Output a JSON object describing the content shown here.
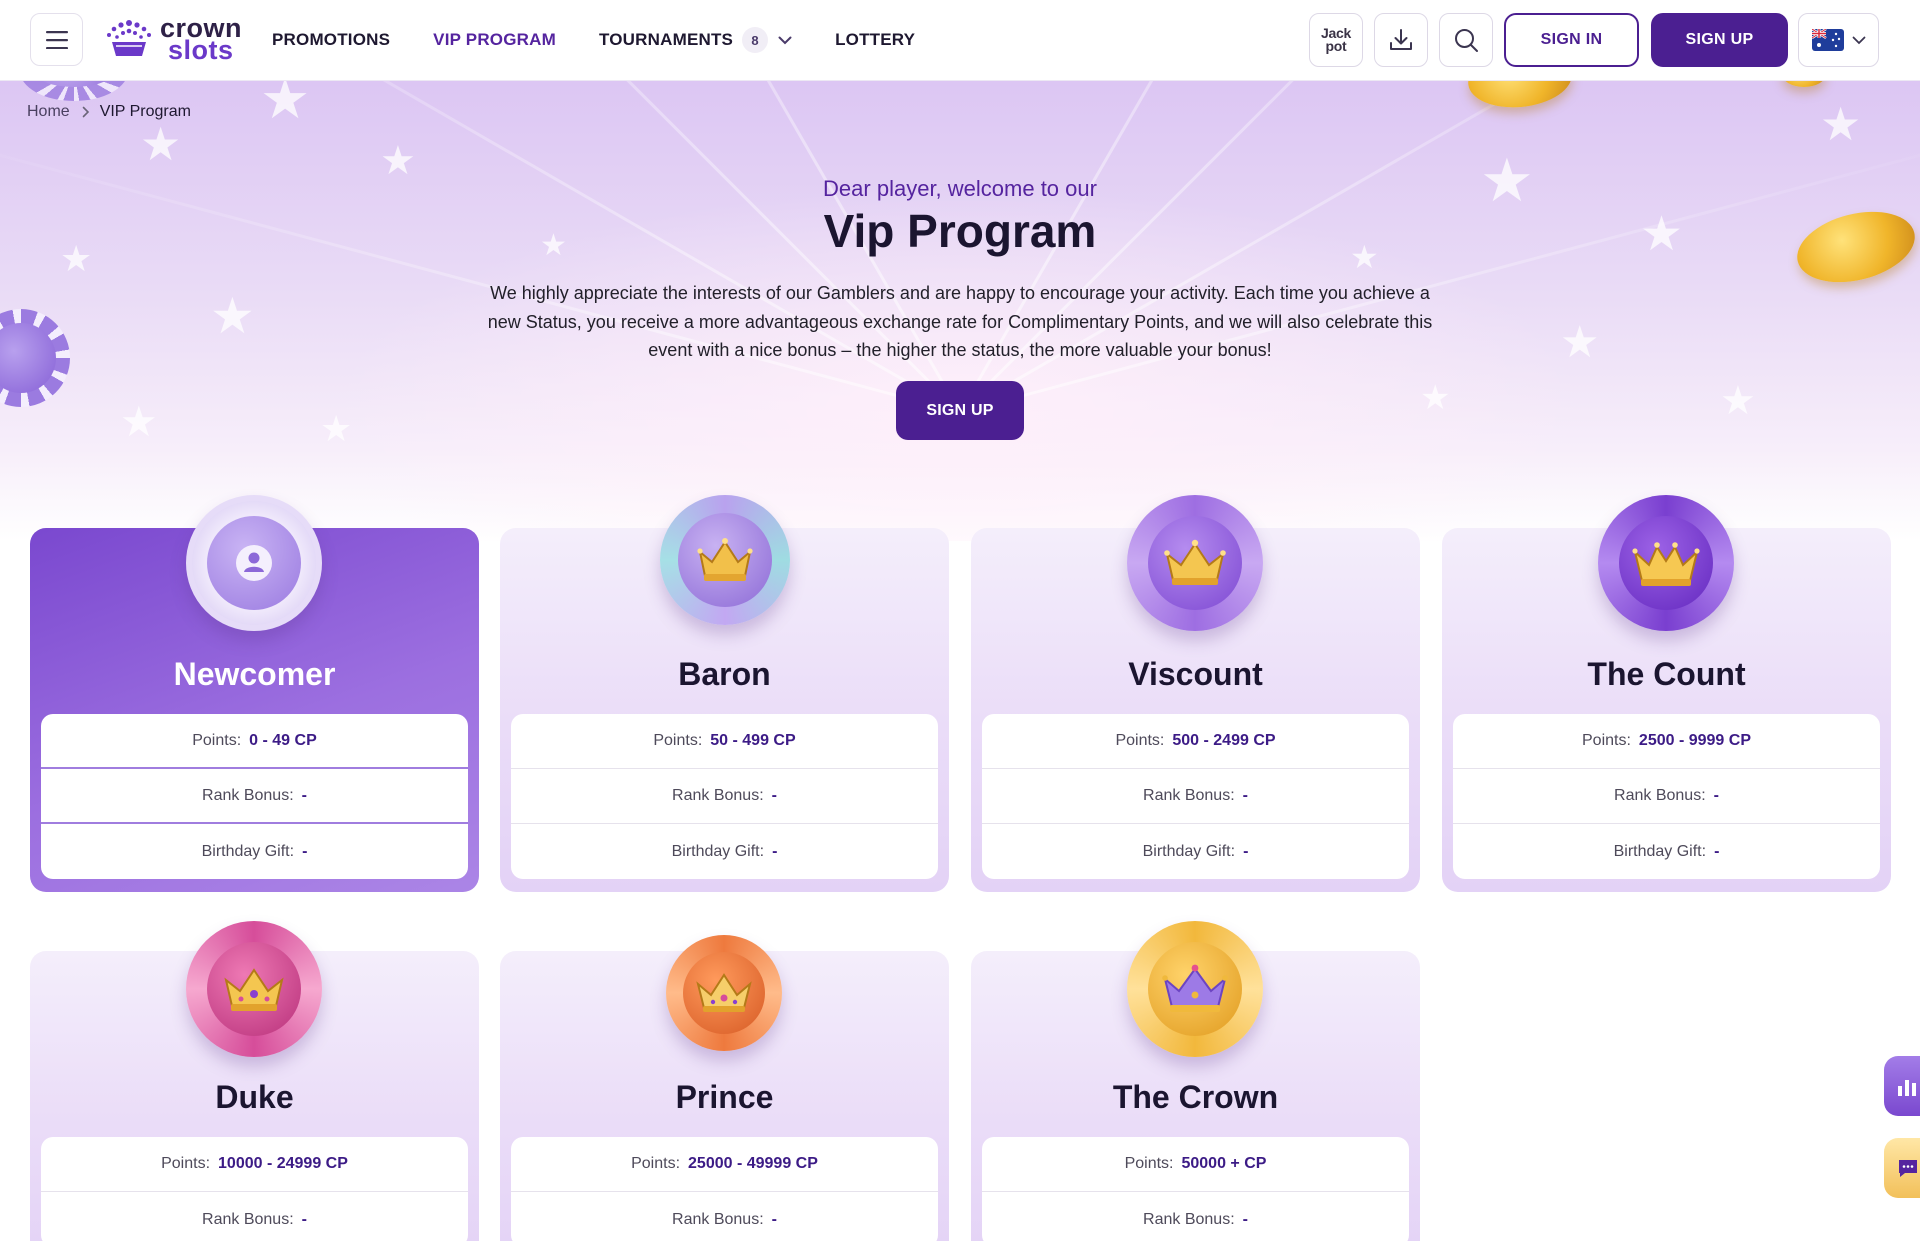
{
  "header": {
    "logo": {
      "line1": "crown",
      "line2": "slots"
    },
    "nav": [
      {
        "label": "PROMOTIONS",
        "active": false
      },
      {
        "label": "VIP PROGRAM",
        "active": true
      },
      {
        "label": "TOURNAMENTS",
        "active": false,
        "badge": "8",
        "has_dropdown": true
      },
      {
        "label": "LOTTERY",
        "active": false
      }
    ],
    "jackpot_label_1": "Jack",
    "jackpot_label_2": "pot",
    "signin_label": "SIGN IN",
    "signup_label": "SIGN UP",
    "language_flag": "australia-flag-icon"
  },
  "breadcrumb": {
    "home": "Home",
    "current": "VIP Program"
  },
  "hero": {
    "subtitle": "Dear player, welcome to our",
    "title": "Vip Program",
    "description": "We highly appreciate the interests of our Gamblers and are happy to encourage your activity. Each time you achieve a new Status, you receive a more advantageous exchange rate for Complimentary Points, and we will also celebrate this event with a nice bonus – the higher the status, the more valuable your bonus!",
    "signup_label": "SIGN UP"
  },
  "labels": {
    "points": "Points:",
    "rank_bonus": "Rank Bonus:",
    "birthday_gift": "Birthday Gift:"
  },
  "levels": [
    {
      "name": "Newcomer",
      "points": "0 - 49 CP",
      "rank_bonus": "-",
      "birthday_gift": "-",
      "icon": "user-icon",
      "current": true
    },
    {
      "name": "Baron",
      "points": "50 - 499 CP",
      "rank_bonus": "-",
      "birthday_gift": "-",
      "icon": "crown-icon"
    },
    {
      "name": "Viscount",
      "points": "500 - 2499 CP",
      "rank_bonus": "-",
      "birthday_gift": "-",
      "icon": "crown-icon"
    },
    {
      "name": "The Count",
      "points": "2500 - 9999 CP",
      "rank_bonus": "-",
      "birthday_gift": "-",
      "icon": "crown-icon"
    },
    {
      "name": "Duke",
      "points": "10000 - 24999 CP",
      "rank_bonus": "-",
      "icon": "crown-icon"
    },
    {
      "name": "Prince",
      "points": "25000 - 49999 CP",
      "rank_bonus": "-",
      "icon": "crown-icon"
    },
    {
      "name": "The Crown",
      "points": "50000 + CP",
      "rank_bonus": "-",
      "icon": "crown-icon"
    }
  ],
  "colors": {
    "brand": "#4b1f91",
    "accent": "#55249f",
    "badge_newcomer": "#c9b8f0",
    "badge_baron": "#b39be8",
    "badge_viscount": "#9362dc",
    "badge_count": "#7a3fd0",
    "badge_duke": "#d64d9a",
    "badge_prince": "#ee7a3e",
    "badge_crown": "#f2b83c"
  }
}
